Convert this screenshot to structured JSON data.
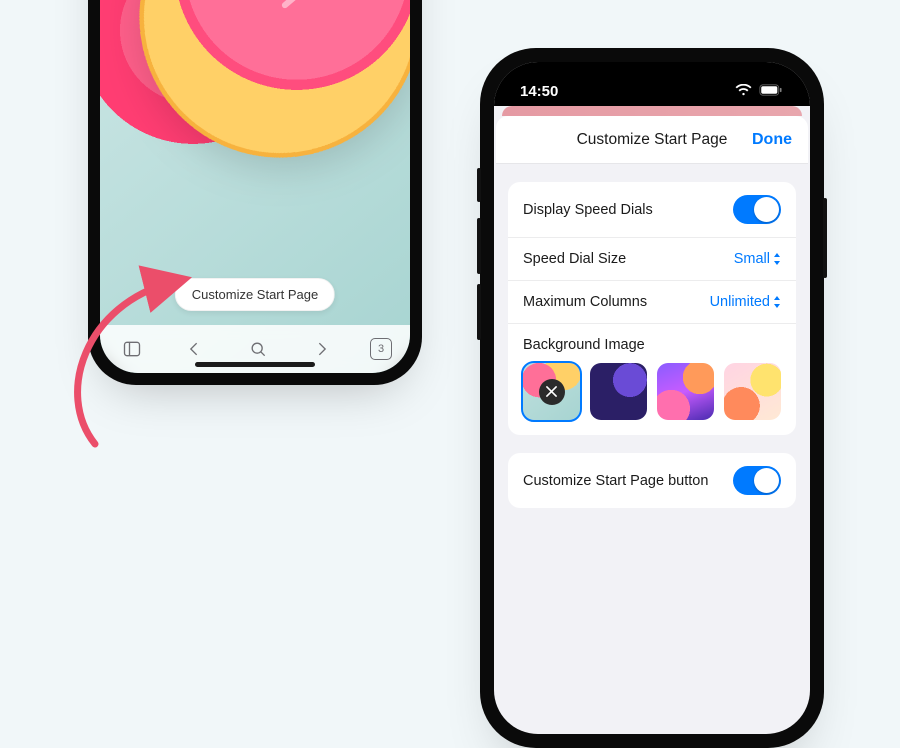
{
  "left": {
    "pill_label": "Customize Start Page",
    "tab_count": "3"
  },
  "right": {
    "status_time": "14:50",
    "sheet_title": "Customize Start Page",
    "done_label": "Done",
    "rows": {
      "display_speed_dials": "Display Speed Dials",
      "speed_dial_size_label": "Speed Dial Size",
      "speed_dial_size_value": "Small",
      "max_columns_label": "Maximum Columns",
      "max_columns_value": "Unlimited",
      "background_image": "Background Image",
      "customize_button": "Customize Start Page button"
    }
  }
}
